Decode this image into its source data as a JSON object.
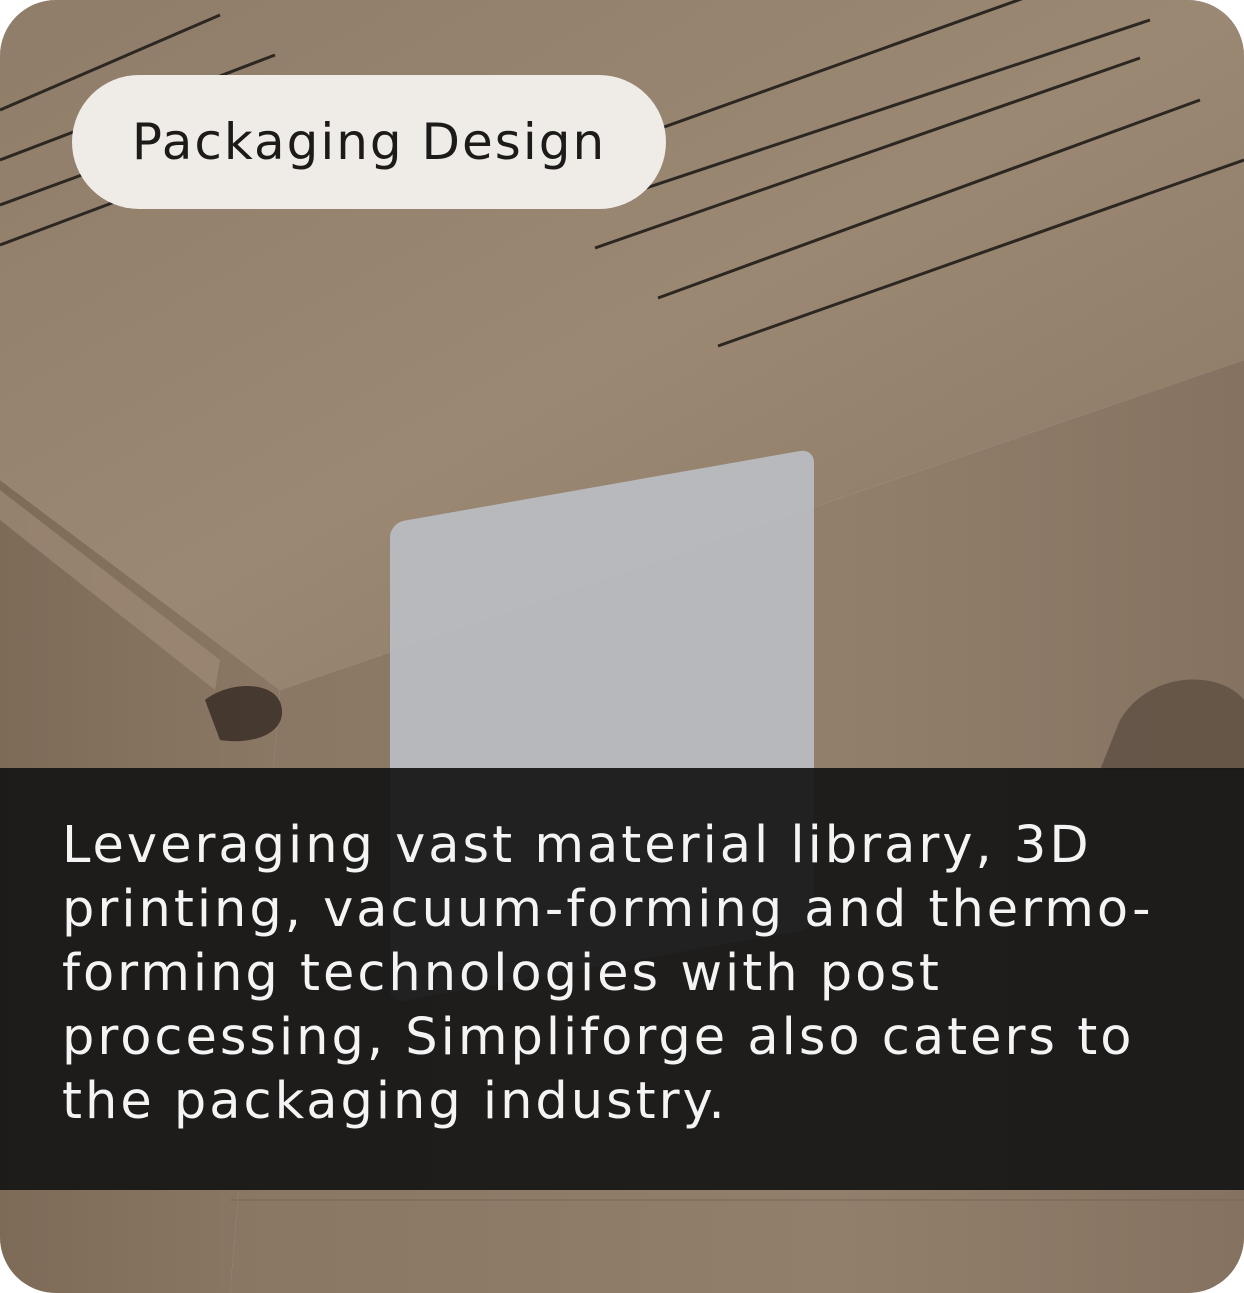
{
  "card": {
    "tag_label": "Packaging Design",
    "description": "Leveraging vast material library, 3D printing, vacuum-forming and thermo-forming technologies with post processing, Simpliforge also caters to the packaging industry."
  },
  "colors": {
    "cardboard": "#9a8672",
    "pill_background": "#efece8",
    "overlay": "#161616",
    "text_light": "#f4f4f4"
  }
}
